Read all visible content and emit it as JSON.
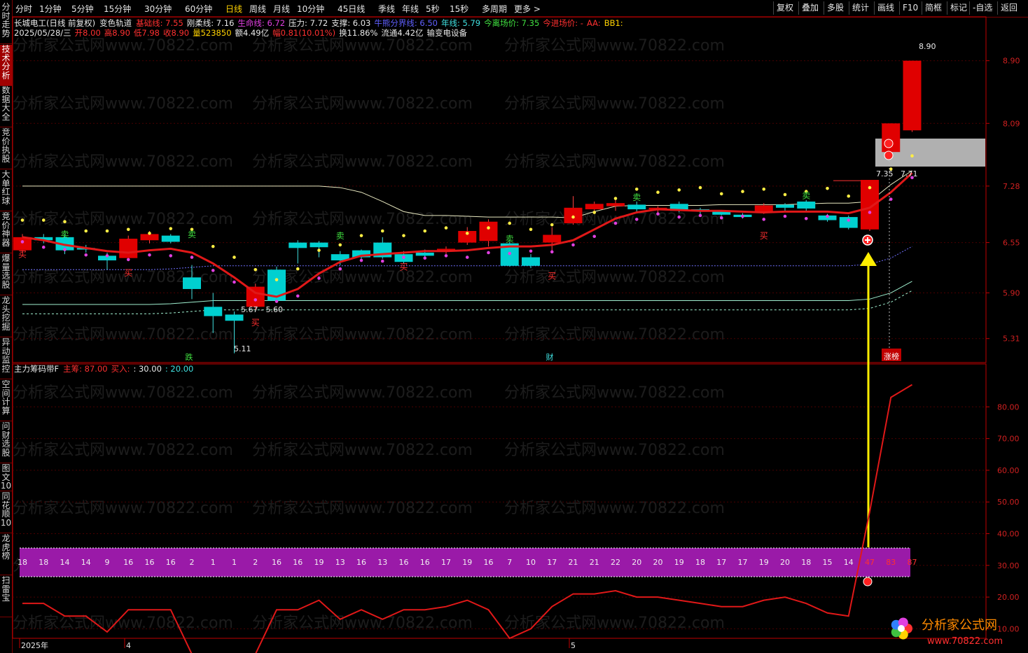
{
  "toolbar": {
    "periods": [
      "分时",
      "1分钟",
      "5分钟",
      "15分钟",
      "30分钟",
      "60分钟",
      "日线",
      "周线",
      "月线",
      "10分钟",
      "45日线",
      "季线",
      "年线",
      "5秒",
      "15秒",
      "多周期",
      "更多 >"
    ],
    "active_index": 6,
    "right_buttons": [
      "复权",
      "叠加",
      "多股",
      "统计",
      "画线",
      "F10",
      "简框",
      "标记",
      "-自选",
      "返回"
    ]
  },
  "sidebar": [
    {
      "label": "分时走势",
      "active": false
    },
    {
      "label": "技术分析",
      "active": true
    },
    {
      "label": "数据大全",
      "active": false
    },
    {
      "label": "竞价执股",
      "active": false
    },
    {
      "label": "大单红球",
      "active": false
    },
    {
      "label": "竞价神器",
      "active": false
    },
    {
      "label": "爆量选股",
      "active": false
    },
    {
      "label": "龙头挖掘",
      "active": false
    },
    {
      "label": "异动监控",
      "active": false
    },
    {
      "label": "空间计算",
      "active": false
    },
    {
      "label": "问财选股",
      "active": false
    },
    {
      "label": "图文10",
      "active": false
    },
    {
      "label": "同花顺10",
      "active": false
    },
    {
      "label": "龙虎榜",
      "active": false
    },
    {
      "label": "扫雷宝",
      "active": false
    }
  ],
  "header1": {
    "stock": "长城电工(日线 前复权)",
    "indicator": "变色轨道",
    "items": [
      {
        "label": "基础线: 7.55",
        "color": "#ff3030"
      },
      {
        "label": "刚柔线: 7.16",
        "color": "#e8e8e8"
      },
      {
        "label": "生命线: 6.72",
        "color": "#e040e0"
      },
      {
        "label": "压力: 7.72",
        "color": "#e8e8e8"
      },
      {
        "label": "支撑: 6.03",
        "color": "#e8e8e8"
      },
      {
        "label": "牛熊分界线: 6.50",
        "color": "#6060ff"
      },
      {
        "label": "年线: 5.79",
        "color": "#40e0e0"
      },
      {
        "label": "今离场价: 7.35",
        "color": "#40e040"
      },
      {
        "label": "今进场价: -",
        "color": "#ff3030"
      },
      {
        "label": "AA:",
        "color": "#ff3030"
      },
      {
        "label": "BB1:",
        "color": "#ffd200"
      }
    ]
  },
  "header2": {
    "items": [
      {
        "label": "2025/05/28/三",
        "color": "#e8e8e8"
      },
      {
        "label": "开8.00",
        "color": "#ff3030"
      },
      {
        "label": "高8.90",
        "color": "#ff3030"
      },
      {
        "label": "低7.98",
        "color": "#ff3030"
      },
      {
        "label": "收8.90",
        "color": "#ff3030"
      },
      {
        "label": "量523850",
        "color": "#ffd200"
      },
      {
        "label": "额4.49亿",
        "color": "#e8e8e8"
      },
      {
        "label": "幅0.81(10.01%)",
        "color": "#ff3030"
      },
      {
        "label": "换11.86%",
        "color": "#e8e8e8"
      },
      {
        "label": "流通4.42亿",
        "color": "#e8e8e8"
      },
      {
        "label": "输变电设备",
        "color": "#e8e8e8"
      }
    ]
  },
  "header3": {
    "indicator": "主力筹码带F",
    "items": [
      {
        "label": "主筹: 87.00",
        "color": "#ff3030"
      },
      {
        "label": "买入:",
        "color": "#ff3030"
      },
      {
        "label": ": 30.00",
        "color": "#e8e8e8"
      },
      {
        "label": ": 20.00",
        "color": "#40e0e0"
      }
    ]
  },
  "watermark": "分析家公式网www.70822.com",
  "logo": {
    "name": "分析家公式网",
    "url": "www.70822.com"
  },
  "colors": {
    "up": "#e00000",
    "down": "#00d0d0",
    "axis": "#c00000",
    "grid": "#4a0000",
    "purple": "#9a1aa8"
  },
  "time_axis": [
    "2025年",
    "4",
    "5"
  ],
  "chart_data": [
    {
      "type": "candlestick",
      "price_ticks": [
        8.9,
        8.09,
        7.28,
        6.55,
        5.9,
        5.31
      ],
      "ylim": [
        5.0,
        9.25
      ],
      "candles": [
        [
          6.45,
          6.62,
          6.66,
          6.42
        ],
        [
          6.62,
          6.58,
          6.66,
          6.54
        ],
        [
          6.62,
          6.45,
          6.66,
          6.4
        ],
        [
          6.48,
          6.46,
          6.52,
          6.42
        ],
        [
          6.38,
          6.32,
          6.42,
          6.2
        ],
        [
          6.35,
          6.6,
          6.64,
          6.32
        ],
        [
          6.58,
          6.66,
          6.7,
          6.54
        ],
        [
          6.64,
          6.56,
          6.66,
          6.54
        ],
        [
          6.1,
          5.95,
          6.26,
          5.82
        ],
        [
          5.72,
          5.6,
          5.9,
          5.38
        ],
        [
          5.62,
          5.54,
          5.66,
          5.12
        ],
        [
          5.72,
          5.98,
          6.02,
          5.68
        ],
        [
          6.2,
          5.8,
          6.24,
          5.78
        ],
        [
          6.55,
          6.48,
          6.58,
          6.28
        ],
        [
          6.55,
          6.49,
          6.57,
          6.36
        ],
        [
          6.4,
          6.32,
          6.44,
          6.26
        ],
        [
          6.45,
          6.36,
          6.46,
          6.3
        ],
        [
          6.55,
          6.36,
          6.62,
          6.34
        ],
        [
          6.4,
          6.3,
          6.44,
          6.28
        ],
        [
          6.42,
          6.38,
          6.46,
          6.36
        ],
        [
          6.45,
          6.47,
          6.5,
          6.4
        ],
        [
          6.55,
          6.7,
          6.75,
          6.52
        ],
        [
          6.57,
          6.82,
          6.85,
          6.5
        ],
        [
          6.54,
          6.25,
          6.56,
          6.24
        ],
        [
          6.36,
          6.25,
          6.4,
          6.22
        ],
        [
          6.55,
          6.65,
          6.75,
          6.42
        ],
        [
          6.8,
          7.0,
          7.15,
          6.78
        ],
        [
          6.98,
          7.05,
          7.08,
          6.92
        ],
        [
          7.02,
          7.06,
          7.1,
          6.96
        ],
        [
          7.04,
          6.98,
          7.08,
          6.95
        ],
        [
          6.98,
          7.0,
          7.02,
          6.94
        ],
        [
          7.05,
          6.96,
          7.08,
          6.94
        ],
        [
          6.98,
          6.96,
          7.0,
          6.92
        ],
        [
          6.95,
          6.91,
          6.97,
          6.9
        ],
        [
          6.91,
          6.88,
          6.93,
          6.86
        ],
        [
          6.94,
          7.03,
          7.06,
          6.92
        ],
        [
          7.04,
          7.0,
          7.06,
          6.96
        ],
        [
          7.08,
          6.99,
          7.1,
          6.96
        ],
        [
          6.9,
          6.84,
          6.92,
          6.82
        ],
        [
          6.88,
          6.74,
          6.9,
          6.72
        ],
        [
          6.72,
          7.36,
          7.36,
          6.7
        ],
        [
          7.72,
          8.09,
          8.09,
          7.65
        ],
        [
          8.0,
          8.9,
          8.9,
          7.98
        ]
      ],
      "upper_line": [
        7.28,
        7.28,
        7.28,
        7.28,
        7.28,
        7.28,
        7.28,
        7.28,
        7.28,
        7.28,
        7.28,
        7.28,
        7.28,
        7.28,
        7.28,
        7.26,
        7.2,
        7.08,
        6.95,
        6.9,
        6.9,
        6.89,
        6.88,
        6.88,
        6.88,
        6.88,
        6.87,
        6.95,
        7.02,
        7.03,
        7.03,
        7.03,
        7.03,
        7.04,
        7.04,
        7.04,
        7.04,
        7.05,
        7.06,
        7.06,
        7.08,
        7.3,
        7.48
      ],
      "lower_line": [
        5.75,
        5.75,
        5.75,
        5.75,
        5.75,
        5.75,
        5.75,
        5.76,
        5.78,
        5.8,
        5.8,
        5.8,
        5.8,
        5.8,
        5.8,
        5.8,
        5.8,
        5.8,
        5.8,
        5.8,
        5.8,
        5.8,
        5.8,
        5.8,
        5.8,
        5.8,
        5.8,
        5.8,
        5.8,
        5.8,
        5.8,
        5.8,
        5.8,
        5.8,
        5.8,
        5.8,
        5.8,
        5.8,
        5.8,
        5.8,
        5.82,
        5.9,
        6.05
      ],
      "red_line": [
        6.62,
        6.58,
        6.52,
        6.48,
        6.44,
        6.42,
        6.45,
        6.47,
        6.42,
        6.28,
        6.1,
        5.9,
        5.85,
        5.95,
        6.15,
        6.3,
        6.38,
        6.4,
        6.42,
        6.44,
        6.44,
        6.45,
        6.48,
        6.5,
        6.5,
        6.52,
        6.58,
        6.72,
        6.86,
        6.94,
        6.98,
        6.97,
        6.96,
        6.96,
        6.95,
        6.94,
        6.95,
        6.95,
        6.95,
        6.93,
        7.0,
        7.2,
        7.45
      ],
      "labels": {
        "low_mark": "5.11",
        "mid_mark": "5.67 - 5.60",
        "high_mark": "8.90",
        "right_a": "7.35",
        "right_b": "7.71",
        "buy": "买",
        "sell": "卖",
        "die": "跌",
        "cai": "财",
        "zt": "涨榜"
      }
    },
    {
      "type": "line",
      "y_ticks": [
        80.0,
        70.0,
        60.0,
        50.0,
        40.0,
        30.0,
        20.0,
        10.0
      ],
      "ylim": [
        7,
        90
      ],
      "values": [
        18,
        18,
        14,
        14,
        9,
        16,
        16,
        16,
        2,
        1,
        1,
        2,
        16,
        16,
        19,
        13,
        16,
        13,
        16,
        16,
        17,
        19,
        16,
        7,
        10,
        17,
        21,
        21,
        22,
        20,
        20,
        19,
        18,
        17,
        17,
        19,
        20,
        18,
        15,
        14,
        47,
        83,
        87
      ]
    }
  ]
}
